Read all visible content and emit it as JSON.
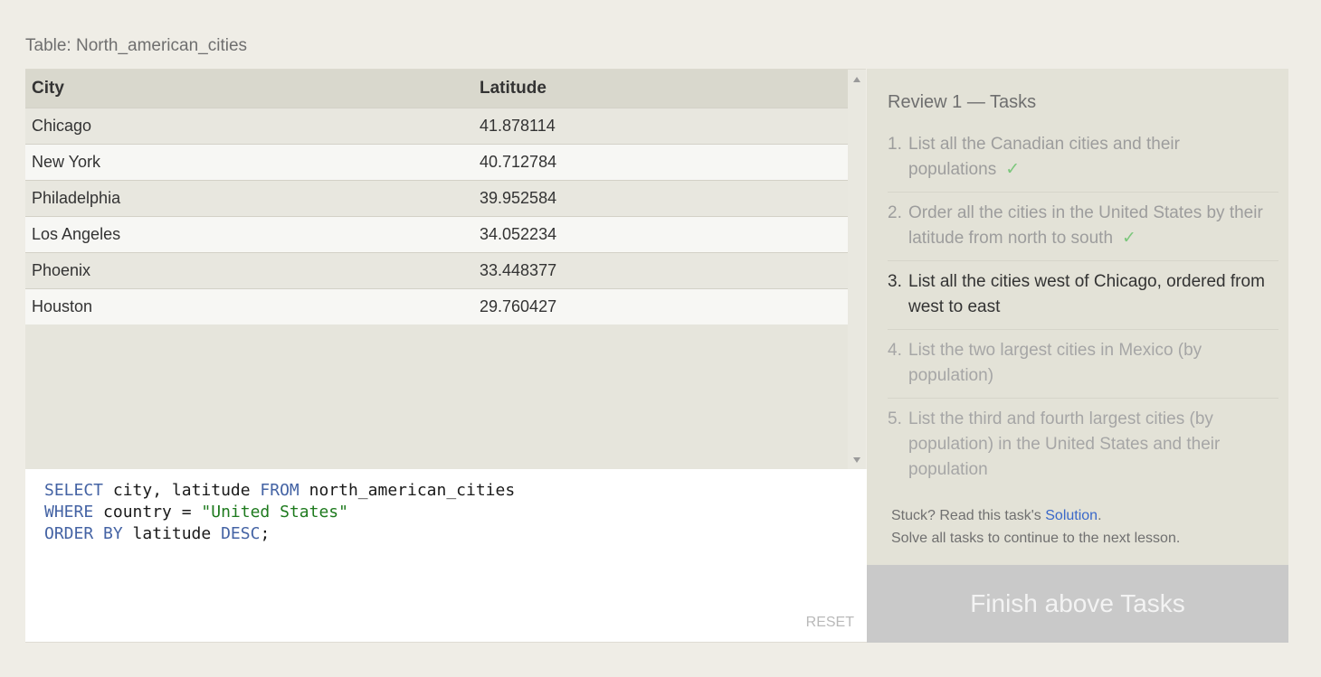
{
  "table": {
    "caption": "Table: North_american_cities",
    "columns": [
      "City",
      "Latitude"
    ],
    "rows": [
      {
        "city": "Chicago",
        "latitude": "41.878114"
      },
      {
        "city": "New York",
        "latitude": "40.712784"
      },
      {
        "city": "Philadelphia",
        "latitude": "39.952584"
      },
      {
        "city": "Los Angeles",
        "latitude": "34.052234"
      },
      {
        "city": "Phoenix",
        "latitude": "33.448377"
      },
      {
        "city": "Houston",
        "latitude": "29.760427"
      }
    ]
  },
  "editor": {
    "line1": {
      "kw1": "SELECT",
      "t1": " city, latitude ",
      "kw2": "FROM",
      "t2": " north_american_cities"
    },
    "line2": {
      "kw1": "WHERE",
      "t1": " country = ",
      "str": "\"United States\""
    },
    "line3": {
      "kw1": "ORDER BY",
      "t1": " latitude ",
      "kw2": "DESC",
      "t2": ";"
    },
    "reset_label": "RESET"
  },
  "tasks": {
    "title": "Review 1 — Tasks",
    "items": [
      {
        "num": "1.",
        "text": "List all the Canadian cities and their populations",
        "state": "done",
        "check": "✓"
      },
      {
        "num": "2.",
        "text": "Order all the cities in the United States by their latitude from north to south",
        "state": "done",
        "check": "✓"
      },
      {
        "num": "3.",
        "text": "List all the cities west of Chicago, ordered from west to east",
        "state": "current"
      },
      {
        "num": "4.",
        "text": "List the two largest cities in Mexico (by population)",
        "state": "pending"
      },
      {
        "num": "5.",
        "text": "List the third and fourth largest cities (by population) in the United States and their population",
        "state": "pending"
      }
    ],
    "stuck_prefix": "Stuck? Read this task's ",
    "solution_link": "Solution",
    "stuck_suffix": ".",
    "solve_all": "Solve all tasks to continue to the next lesson."
  },
  "finish_button": "Finish above Tasks",
  "colors": {
    "keyword": "#4463a4",
    "string": "#1e7a1e",
    "check": "#7cc77c",
    "link": "#3a68c9"
  }
}
